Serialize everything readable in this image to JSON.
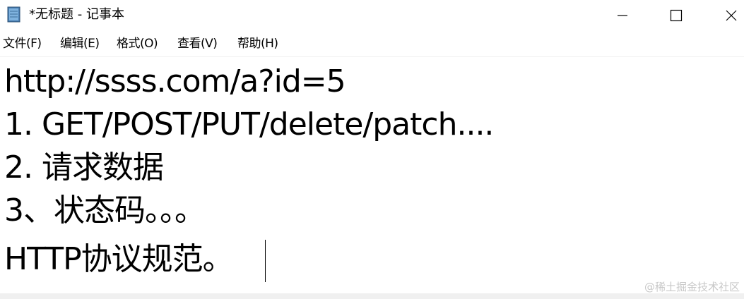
{
  "window": {
    "title": "*无标题 - 记事本",
    "app_icon": "notepad-icon",
    "controls": {
      "minimize_icon": "minimize-icon",
      "maximize_icon": "maximize-icon",
      "close_icon": "close-icon"
    }
  },
  "menu": {
    "items": [
      {
        "label": "文件(F)"
      },
      {
        "label": "编辑(E)"
      },
      {
        "label": "格式(O)"
      },
      {
        "label": "查看(V)"
      },
      {
        "label": "帮助(H)"
      }
    ]
  },
  "editor": {
    "lines": [
      "http://ssss.com/a?id=5",
      "1. GET/POST/PUT/delete/patch....",
      "2. 请求数据",
      "3、状态码。。。",
      "HTTP协议规范。"
    ]
  },
  "watermark": "@稀土掘金技术社区",
  "colors": {
    "background": "#ffffff",
    "text": "#000000",
    "watermark": "#c8c8c8"
  }
}
